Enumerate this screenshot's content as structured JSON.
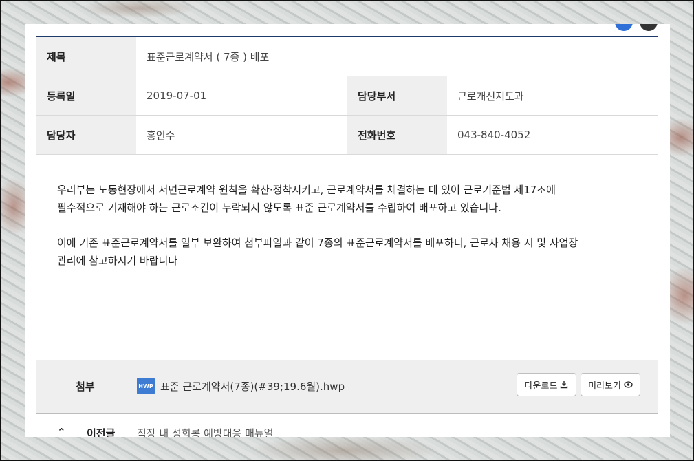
{
  "info": {
    "title_label": "제목",
    "title_value": "표준근로계약서 ( 7종 ) 배포",
    "date_label": "등록일",
    "date_value": "2019-07-01",
    "dept_label": "담당부서",
    "dept_value": "근로개선지도과",
    "person_label": "담당자",
    "person_value": "홍인수",
    "phone_label": "전화번호",
    "phone_value": "043-840-4052"
  },
  "content": {
    "paragraph1_line1": "우리부는 노동현장에서 서면근로계약 원칙을 확산·정착시키고, 근로계약서를 체결하는 데 있어 근로기준법 제17조에",
    "paragraph1_line2": "필수적으로 기재해야 하는 근로조건이 누락되지 않도록 표준 근로계약서를 수립하여 배포하고 있습니다.",
    "paragraph2_line1": "이에 기존 표준근로계약서를 일부 보완하여 첨부파일과 같이 7종의 표준근로계약서를 배포하니, 근로자 채용 시 및 사업장",
    "paragraph2_line2": "관리에 참고하시기 바랍니다"
  },
  "attachment": {
    "label": "첨부",
    "file_icon_text": "HWP",
    "file_name": "표준 근로계약서(7종)(#39;19.6월).hwp",
    "download_label": "다운로드",
    "preview_label": "미리보기",
    "file_icon": "hwp-file-icon"
  },
  "prev": {
    "label": "이전글",
    "title": "직장 내 성희롱 예방대응 매뉴얼"
  }
}
